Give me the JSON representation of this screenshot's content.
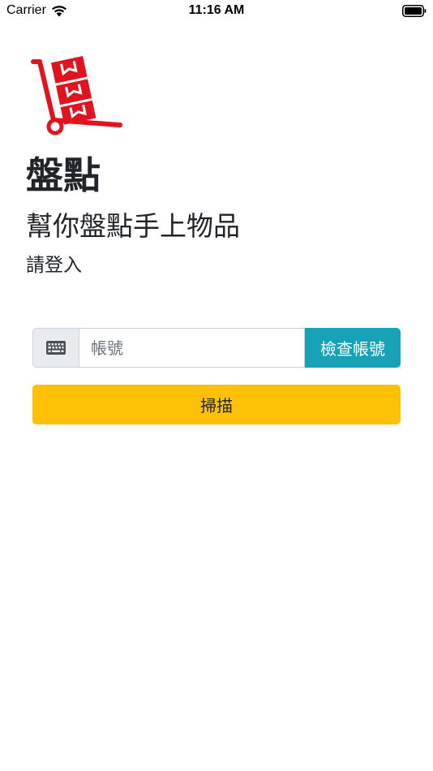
{
  "status_bar": {
    "carrier": "Carrier",
    "time": "11:16 AM",
    "icons": [
      "wifi-icon",
      "battery-icon"
    ]
  },
  "header": {
    "logo_icon": "hand-truck-boxes-icon",
    "title": "盤點",
    "subtitle": "幫你盤點手上物品",
    "prompt": "請登入"
  },
  "login": {
    "addon_icon": "keyboard-icon",
    "account_placeholder": "帳號",
    "account_value": "",
    "check_button_label": "檢查帳號",
    "scan_button_label": "掃描"
  },
  "colors": {
    "logo_red": "#e0141e",
    "check_button": "#17a2b8",
    "scan_button": "#ffc107",
    "addon_background": "#e9ecef"
  }
}
